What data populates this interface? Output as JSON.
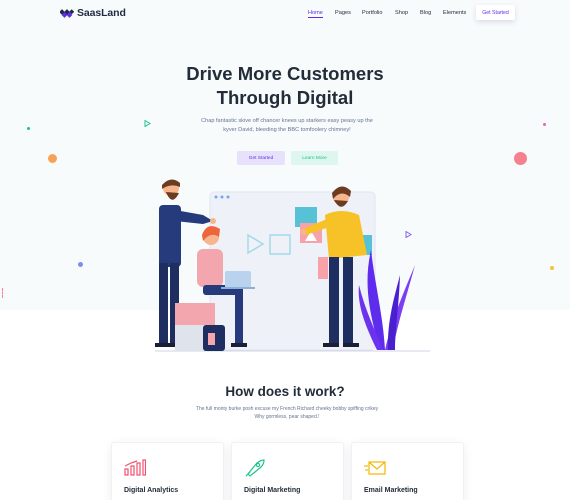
{
  "brand": {
    "name": "SaasLand"
  },
  "nav": {
    "items": [
      "Home",
      "Pages",
      "Portfolio",
      "Shop",
      "Blog",
      "Elements"
    ],
    "active": "Home",
    "cta_label": "Get Started"
  },
  "hero": {
    "title_line1": "Drive More Customers",
    "title_line2": "Through Digital",
    "subtitle_line1": "Chap fantastic skive off chancer knees up starkers easy peasy up the",
    "subtitle_line2": "kyver David, bleeding the BBC tomfoolery chimney!",
    "primary_button": "Get Started",
    "secondary_button": "Learn More"
  },
  "how": {
    "title": "How does it work?",
    "subtitle_line1": "The full monty burke posh excuse my French Richard cheeky bobby spiffing crikey",
    "subtitle_line2": "Why gormless, pear shaped.!"
  },
  "cards": [
    {
      "title": "Digital Analytics",
      "icon": "bar-chart-icon",
      "color": "#f0506e"
    },
    {
      "title": "Digital Marketing",
      "icon": "rocket-icon",
      "color": "#1ec38b"
    },
    {
      "title": "Email Marketing",
      "icon": "email-icon",
      "color": "#f5b600"
    }
  ],
  "colors": {
    "accent": "#5e2ced",
    "green": "#1ec38b",
    "heading": "#222d39",
    "text": "#677294"
  }
}
